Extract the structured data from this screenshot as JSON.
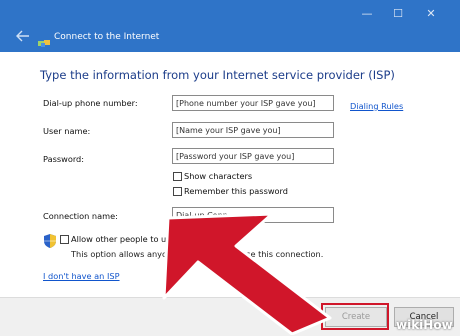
{
  "window": {
    "title": "Connect to the Internet",
    "back_icon": "back-arrow-icon",
    "network_icon": "network-icon",
    "controls": {
      "minimize": "—",
      "maximize": "☐",
      "close": "✕"
    }
  },
  "heading": "Type the information from your Internet service provider (ISP)",
  "form": {
    "phone": {
      "label": "Dial-up phone number:",
      "placeholder": "[Phone number your ISP gave you]"
    },
    "dialing_rules": "Dialing Rules",
    "username": {
      "label": "User name:",
      "placeholder": "[Name your ISP gave you]"
    },
    "password": {
      "label": "Password:",
      "placeholder": "[Password your ISP gave you]"
    },
    "show_characters": {
      "label": "Show characters",
      "checked": false
    },
    "remember_password": {
      "label": "Remember this password",
      "checked": false
    },
    "connection_name": {
      "label": "Connection name:",
      "value": "Dial-up Conn"
    },
    "allow_others": {
      "label": "Allow other people to us",
      "description": "This option allows anyone wit",
      "description_tail": "use this connection.",
      "checked": false,
      "shield_icon": "uac-shield-icon"
    },
    "no_isp_link": "I don't have an ISP"
  },
  "buttons": {
    "create": "Create",
    "cancel": "Cancel"
  },
  "colors": {
    "titlebar": "#2f74c8",
    "heading": "#1c3d8a",
    "link": "#1155cc",
    "arrow": "#d0162a"
  },
  "overlay": {
    "arrow_icon": "red-pointer-arrow",
    "watermark": "wikiHow"
  }
}
